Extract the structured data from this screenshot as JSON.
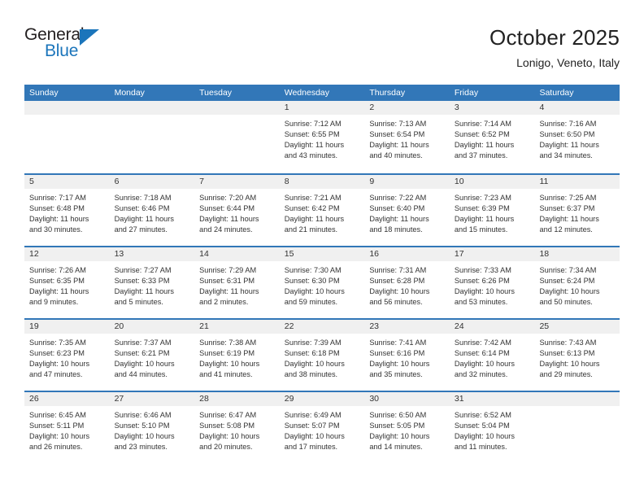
{
  "logo": {
    "general_text": "General",
    "blue_text": "Blue",
    "triangle_color": "#1b75bb"
  },
  "header": {
    "title": "October 2025",
    "subtitle": "Lonigo, Veneto, Italy"
  },
  "theme": {
    "header_blue": "#3277b8",
    "day_band_gray": "#f0f0f0",
    "text": "#333333"
  },
  "weekdays": [
    "Sunday",
    "Monday",
    "Tuesday",
    "Wednesday",
    "Thursday",
    "Friday",
    "Saturday"
  ],
  "weeks": [
    [
      {
        "empty": true
      },
      {
        "empty": true
      },
      {
        "empty": true
      },
      {
        "date": "1",
        "l1": "Sunrise: 7:12 AM",
        "l2": "Sunset: 6:55 PM",
        "l3": "Daylight: 11 hours",
        "l4": "and 43 minutes."
      },
      {
        "date": "2",
        "l1": "Sunrise: 7:13 AM",
        "l2": "Sunset: 6:54 PM",
        "l3": "Daylight: 11 hours",
        "l4": "and 40 minutes."
      },
      {
        "date": "3",
        "l1": "Sunrise: 7:14 AM",
        "l2": "Sunset: 6:52 PM",
        "l3": "Daylight: 11 hours",
        "l4": "and 37 minutes."
      },
      {
        "date": "4",
        "l1": "Sunrise: 7:16 AM",
        "l2": "Sunset: 6:50 PM",
        "l3": "Daylight: 11 hours",
        "l4": "and 34 minutes."
      }
    ],
    [
      {
        "date": "5",
        "l1": "Sunrise: 7:17 AM",
        "l2": "Sunset: 6:48 PM",
        "l3": "Daylight: 11 hours",
        "l4": "and 30 minutes."
      },
      {
        "date": "6",
        "l1": "Sunrise: 7:18 AM",
        "l2": "Sunset: 6:46 PM",
        "l3": "Daylight: 11 hours",
        "l4": "and 27 minutes."
      },
      {
        "date": "7",
        "l1": "Sunrise: 7:20 AM",
        "l2": "Sunset: 6:44 PM",
        "l3": "Daylight: 11 hours",
        "l4": "and 24 minutes."
      },
      {
        "date": "8",
        "l1": "Sunrise: 7:21 AM",
        "l2": "Sunset: 6:42 PM",
        "l3": "Daylight: 11 hours",
        "l4": "and 21 minutes."
      },
      {
        "date": "9",
        "l1": "Sunrise: 7:22 AM",
        "l2": "Sunset: 6:40 PM",
        "l3": "Daylight: 11 hours",
        "l4": "and 18 minutes."
      },
      {
        "date": "10",
        "l1": "Sunrise: 7:23 AM",
        "l2": "Sunset: 6:39 PM",
        "l3": "Daylight: 11 hours",
        "l4": "and 15 minutes."
      },
      {
        "date": "11",
        "l1": "Sunrise: 7:25 AM",
        "l2": "Sunset: 6:37 PM",
        "l3": "Daylight: 11 hours",
        "l4": "and 12 minutes."
      }
    ],
    [
      {
        "date": "12",
        "l1": "Sunrise: 7:26 AM",
        "l2": "Sunset: 6:35 PM",
        "l3": "Daylight: 11 hours",
        "l4": "and 9 minutes."
      },
      {
        "date": "13",
        "l1": "Sunrise: 7:27 AM",
        "l2": "Sunset: 6:33 PM",
        "l3": "Daylight: 11 hours",
        "l4": "and 5 minutes."
      },
      {
        "date": "14",
        "l1": "Sunrise: 7:29 AM",
        "l2": "Sunset: 6:31 PM",
        "l3": "Daylight: 11 hours",
        "l4": "and 2 minutes."
      },
      {
        "date": "15",
        "l1": "Sunrise: 7:30 AM",
        "l2": "Sunset: 6:30 PM",
        "l3": "Daylight: 10 hours",
        "l4": "and 59 minutes."
      },
      {
        "date": "16",
        "l1": "Sunrise: 7:31 AM",
        "l2": "Sunset: 6:28 PM",
        "l3": "Daylight: 10 hours",
        "l4": "and 56 minutes."
      },
      {
        "date": "17",
        "l1": "Sunrise: 7:33 AM",
        "l2": "Sunset: 6:26 PM",
        "l3": "Daylight: 10 hours",
        "l4": "and 53 minutes."
      },
      {
        "date": "18",
        "l1": "Sunrise: 7:34 AM",
        "l2": "Sunset: 6:24 PM",
        "l3": "Daylight: 10 hours",
        "l4": "and 50 minutes."
      }
    ],
    [
      {
        "date": "19",
        "l1": "Sunrise: 7:35 AM",
        "l2": "Sunset: 6:23 PM",
        "l3": "Daylight: 10 hours",
        "l4": "and 47 minutes."
      },
      {
        "date": "20",
        "l1": "Sunrise: 7:37 AM",
        "l2": "Sunset: 6:21 PM",
        "l3": "Daylight: 10 hours",
        "l4": "and 44 minutes."
      },
      {
        "date": "21",
        "l1": "Sunrise: 7:38 AM",
        "l2": "Sunset: 6:19 PM",
        "l3": "Daylight: 10 hours",
        "l4": "and 41 minutes."
      },
      {
        "date": "22",
        "l1": "Sunrise: 7:39 AM",
        "l2": "Sunset: 6:18 PM",
        "l3": "Daylight: 10 hours",
        "l4": "and 38 minutes."
      },
      {
        "date": "23",
        "l1": "Sunrise: 7:41 AM",
        "l2": "Sunset: 6:16 PM",
        "l3": "Daylight: 10 hours",
        "l4": "and 35 minutes."
      },
      {
        "date": "24",
        "l1": "Sunrise: 7:42 AM",
        "l2": "Sunset: 6:14 PM",
        "l3": "Daylight: 10 hours",
        "l4": "and 32 minutes."
      },
      {
        "date": "25",
        "l1": "Sunrise: 7:43 AM",
        "l2": "Sunset: 6:13 PM",
        "l3": "Daylight: 10 hours",
        "l4": "and 29 minutes."
      }
    ],
    [
      {
        "date": "26",
        "l1": "Sunrise: 6:45 AM",
        "l2": "Sunset: 5:11 PM",
        "l3": "Daylight: 10 hours",
        "l4": "and 26 minutes."
      },
      {
        "date": "27",
        "l1": "Sunrise: 6:46 AM",
        "l2": "Sunset: 5:10 PM",
        "l3": "Daylight: 10 hours",
        "l4": "and 23 minutes."
      },
      {
        "date": "28",
        "l1": "Sunrise: 6:47 AM",
        "l2": "Sunset: 5:08 PM",
        "l3": "Daylight: 10 hours",
        "l4": "and 20 minutes."
      },
      {
        "date": "29",
        "l1": "Sunrise: 6:49 AM",
        "l2": "Sunset: 5:07 PM",
        "l3": "Daylight: 10 hours",
        "l4": "and 17 minutes."
      },
      {
        "date": "30",
        "l1": "Sunrise: 6:50 AM",
        "l2": "Sunset: 5:05 PM",
        "l3": "Daylight: 10 hours",
        "l4": "and 14 minutes."
      },
      {
        "date": "31",
        "l1": "Sunrise: 6:52 AM",
        "l2": "Sunset: 5:04 PM",
        "l3": "Daylight: 10 hours",
        "l4": "and 11 minutes."
      },
      {
        "empty": true
      }
    ]
  ]
}
